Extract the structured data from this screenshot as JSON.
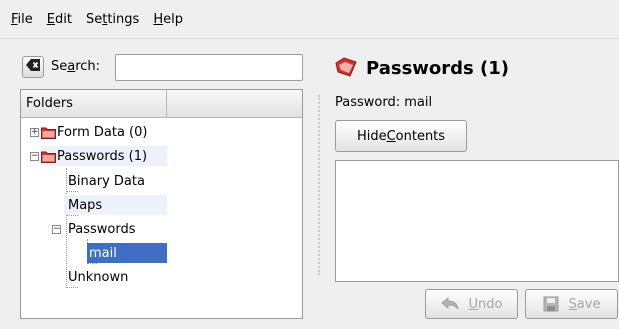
{
  "menu": [
    {
      "pre": "",
      "u": "F",
      "post": "ile"
    },
    {
      "pre": "",
      "u": "E",
      "post": "dit"
    },
    {
      "pre": "Se",
      "u": "t",
      "post": "tings"
    },
    {
      "pre": "",
      "u": "H",
      "post": "elp"
    }
  ],
  "search": {
    "pre": "Se",
    "u": "a",
    "post": "rch:",
    "value": ""
  },
  "tree": {
    "header": "Folders",
    "nodes": {
      "form_data": "Form Data (0)",
      "passwords_root": "Passwords (1)",
      "binary_data": "Binary Data",
      "maps": "Maps",
      "passwords_sub": "Passwords",
      "mail": "mail",
      "unknown": "Unknown"
    }
  },
  "detail": {
    "title": "Passwords (1)",
    "password_label": "Password: mail",
    "hide_contents": {
      "pre": "Hide ",
      "u": "C",
      "post": "ontents"
    },
    "undo": {
      "pre": "",
      "u": "U",
      "post": "ndo"
    },
    "save": {
      "pre": "",
      "u": "S",
      "post": "ave"
    }
  },
  "colors": {
    "selection": "#3e6fc5",
    "folder_icon": "#d3322c",
    "row_shade": "#edf2fa"
  }
}
